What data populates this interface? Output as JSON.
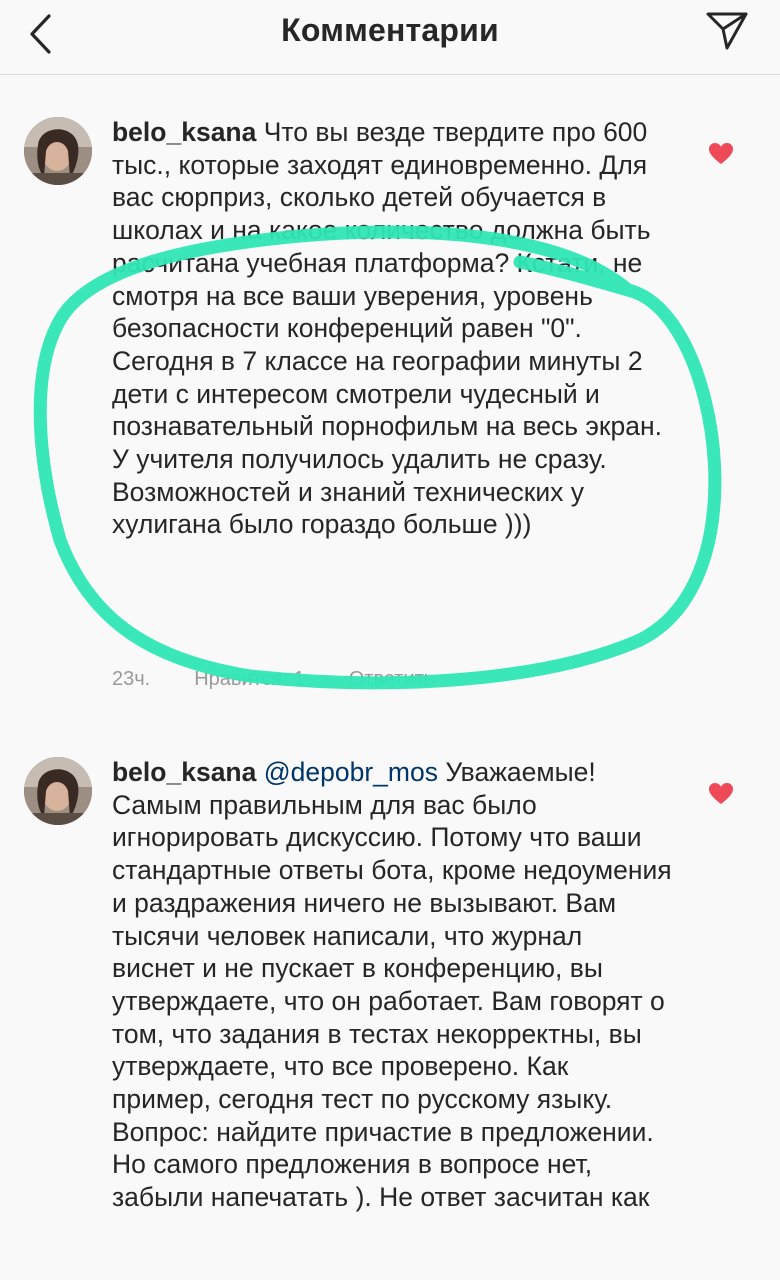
{
  "header": {
    "title": "Комментарии",
    "back_icon": "chevron-left-icon",
    "share_icon": "paper-plane-icon"
  },
  "comments": [
    {
      "username": "belo_ksana",
      "mention": "",
      "text": "Что вы везде твердите про 600 тыс., которые заходят единовременно. Для вас сюрприз, сколько детей обучается в школах и на какое количество должна быть расчитана учебная платформа? Кстати, не смотря на все ваши уверения, уровень безопасности конференций равен \"0\". Сегодня в 7 классе на географии минуты 2 дети с интересом смотрели чудесный и познавательный порнофильм на весь экран. У учителя получилось удалить не сразу. Возможностей и знаний технических у хулигана было гораздо больше )))",
      "time": "23ч.",
      "likes": "Нравится: 1",
      "reply": "Ответить",
      "liked": true
    },
    {
      "username": "belo_ksana",
      "mention": "@depobr_mos",
      "text": "Уважаемые! Самым правильным для вас было игнорировать дискуссию. Потому что ваши стандартные ответы бота, кроме недоумения и раздражения ничего не вызывают. Вам тысячи человек написали, что журнал виснет и не пускает в конференцию, вы утверждаете, что он работает. Вам говорят о том, что задания в тестах некорректны, вы утверждаете, что все проверено. Как пример, сегодня тест по русскому языку. Вопрос: найдите причастие в предложении. Но самого предложения в вопросе нет, забыли напечатать ). Не ответ засчитан как",
      "liked": true
    }
  ],
  "colors": {
    "heart": "#ed4956",
    "highlight": "#2ee6b4",
    "mention": "#003569",
    "meta": "#999999"
  }
}
